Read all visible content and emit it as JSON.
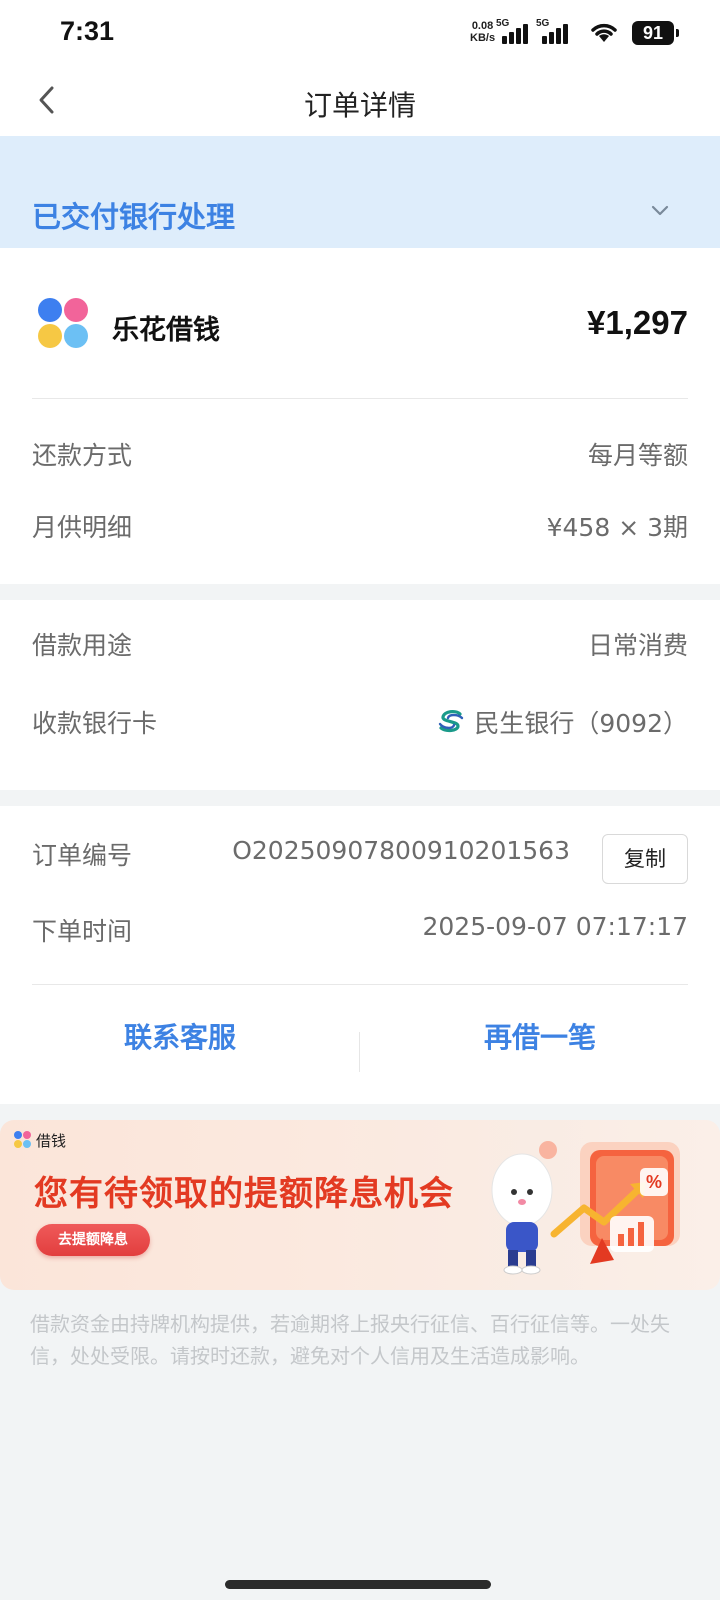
{
  "status_bar": {
    "time": "7:31",
    "net_speed_value": "0.08",
    "net_speed_unit": "KB/s",
    "sim1": "5G",
    "sim2": "5G",
    "battery": "91"
  },
  "nav": {
    "back_icon": "chevron-left-icon",
    "title": "订单详情"
  },
  "order_status": {
    "label": "已交付银行处理",
    "expand_icon": "chevron-down-icon"
  },
  "product": {
    "logo_icon": "lehua-logo-icon",
    "name": "乐花借钱",
    "amount": "¥1,297"
  },
  "repayment": {
    "method_label": "还款方式",
    "method_value": "每月等额",
    "monthly_label": "月供明细",
    "monthly_value": "¥458 × 3期"
  },
  "loan_info": {
    "purpose_label": "借款用途",
    "purpose_value": "日常消费",
    "card_label": "收款银行卡",
    "bank_icon": "cmbc-bank-icon",
    "card_value": "民生银行（9092）"
  },
  "order_info": {
    "number_label": "订单编号",
    "number_value": "O20250907800910201563",
    "copy_label": "复制",
    "time_label": "下单时间",
    "time_value": "2025-09-07 07:17:17"
  },
  "actions": {
    "contact": "联系客服",
    "borrow_again": "再借一笔"
  },
  "promo": {
    "brand": "借钱",
    "headline": "您有待领取的提额降息机会",
    "cta": "去提额降息",
    "percent_symbol": "%"
  },
  "disclaimer": "借款资金由持牌机构提供，若逾期将上报央行征信、百行征信等。一处失信，处处受限。请按时还款，避免对个人信用及生活造成影响。",
  "colors": {
    "accent": "#3d82e3",
    "banner_bg": "#deedfb",
    "promo_red": "#e33a22"
  }
}
